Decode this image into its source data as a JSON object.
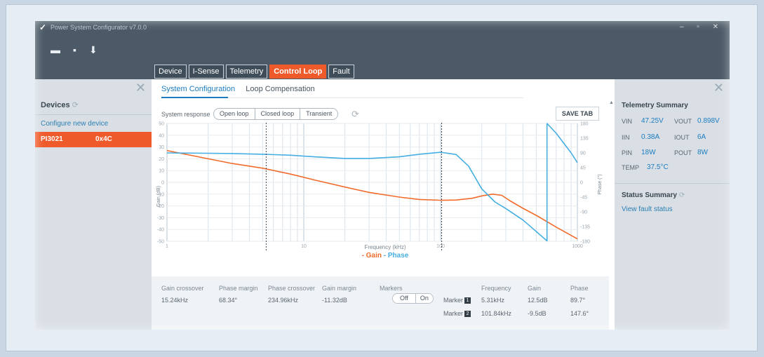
{
  "app": {
    "title": "Power System Configurator v7.0.0",
    "logo": "✓",
    "window_controls": "– ▫ ✕"
  },
  "toolbar": {
    "open_icon": "▬",
    "save_icon": "▪",
    "download_icon": "⬇"
  },
  "tabs": [
    {
      "label": "Device"
    },
    {
      "label": "I-Sense"
    },
    {
      "label": "Telemetry"
    },
    {
      "label": "Control Loop",
      "active": true
    },
    {
      "label": "Fault"
    }
  ],
  "left_panel": {
    "close": "✕",
    "devices_title": "Devices",
    "configure_link": "Configure new device",
    "device": {
      "name": "PI3021",
      "address": "0x4C"
    }
  },
  "main": {
    "subtabs": [
      "System Configuration",
      "Loop Compensation"
    ],
    "system_response_label": "System response",
    "response_buttons": [
      "Open loop",
      "Closed loop",
      "Transient"
    ],
    "save_tab": "SAVE TAB"
  },
  "chart_data": {
    "type": "line",
    "x_scale": "log",
    "xlabel": "Frequency (kHz)",
    "ylabel_left": "Gain (dB)",
    "ylabel_right": "Phase (°)",
    "xlim": [
      1,
      1000
    ],
    "ylim_left": [
      -50,
      50
    ],
    "ylim_right": [
      -180,
      180
    ],
    "x_ticks": [
      "1",
      "10",
      "100",
      "1000"
    ],
    "y_ticks_left": [
      "50",
      "40",
      "30",
      "20",
      "10",
      "0",
      "-10",
      "-20",
      "-30",
      "-40",
      "-50"
    ],
    "y_ticks_right": [
      "180",
      "135",
      "90",
      "45",
      "0",
      "-45",
      "-90",
      "-135",
      "-180"
    ],
    "legend": [
      "Gain",
      "Phase"
    ],
    "series": [
      {
        "name": "Gain",
        "color": "#f26b2b",
        "axis": "left",
        "x": [
          1,
          2,
          3,
          5,
          8,
          12,
          20,
          30,
          50,
          70,
          100,
          130,
          170,
          200,
          240,
          280,
          320,
          400,
          500,
          700,
          1000
        ],
        "y": [
          27,
          20,
          16,
          12,
          7,
          2,
          -4,
          -8.5,
          -12.5,
          -14.5,
          -15.2,
          -15,
          -13.5,
          -11.5,
          -10,
          -11,
          -15.5,
          -22,
          -28,
          -38,
          -48
        ]
      },
      {
        "name": "Phase",
        "color": "#45aee2",
        "axis": "right",
        "x": [
          1,
          2,
          3,
          5,
          8,
          12,
          20,
          30,
          50,
          70,
          100,
          130,
          160,
          200,
          250,
          300,
          400,
          500,
          599.9,
          600,
          700,
          900,
          1000
        ],
        "y": [
          90,
          89,
          88,
          86,
          83,
          78,
          73,
          73,
          78,
          86,
          92,
          85,
          50,
          -20,
          -60,
          -80,
          -115,
          -150,
          -179,
          180,
          150,
          90,
          60
        ]
      }
    ],
    "markers": [
      {
        "label": "1",
        "x": 5.31
      },
      {
        "label": "2",
        "x": 101.84
      }
    ]
  },
  "stats": {
    "headers": [
      "Gain crossover",
      "Phase margin",
      "Phase crossover",
      "Gain margin",
      "Markers",
      "Frequency",
      "Gain",
      "Phase"
    ],
    "values": [
      "15.24kHz",
      "68.34°",
      "234.96kHz",
      "-11.32dB"
    ],
    "markers_toggle": [
      "Off",
      "On"
    ],
    "marker_label": "Marker",
    "marker_rows": [
      {
        "id": "1",
        "frequency": "5.31kHz",
        "gain": "12.5dB",
        "phase": "89.7°"
      },
      {
        "id": "2",
        "frequency": "101.84kHz",
        "gain": "-9.5dB",
        "phase": "147.6°"
      }
    ]
  },
  "right_panel": {
    "close": "✕",
    "telemetry_title": "Telemetry Summary",
    "telemetry": [
      {
        "label": "VIN",
        "value": "47.25V"
      },
      {
        "label": "VOUT",
        "value": "0.898V"
      },
      {
        "label": "IIN",
        "value": "0.38A"
      },
      {
        "label": "IOUT",
        "value": "6A"
      },
      {
        "label": "PIN",
        "value": "18W"
      },
      {
        "label": "POUT",
        "value": "8W"
      },
      {
        "label": "TEMP",
        "value": "37.5°C"
      }
    ],
    "status_title": "Status Summary",
    "fault_link": "View fault status"
  }
}
